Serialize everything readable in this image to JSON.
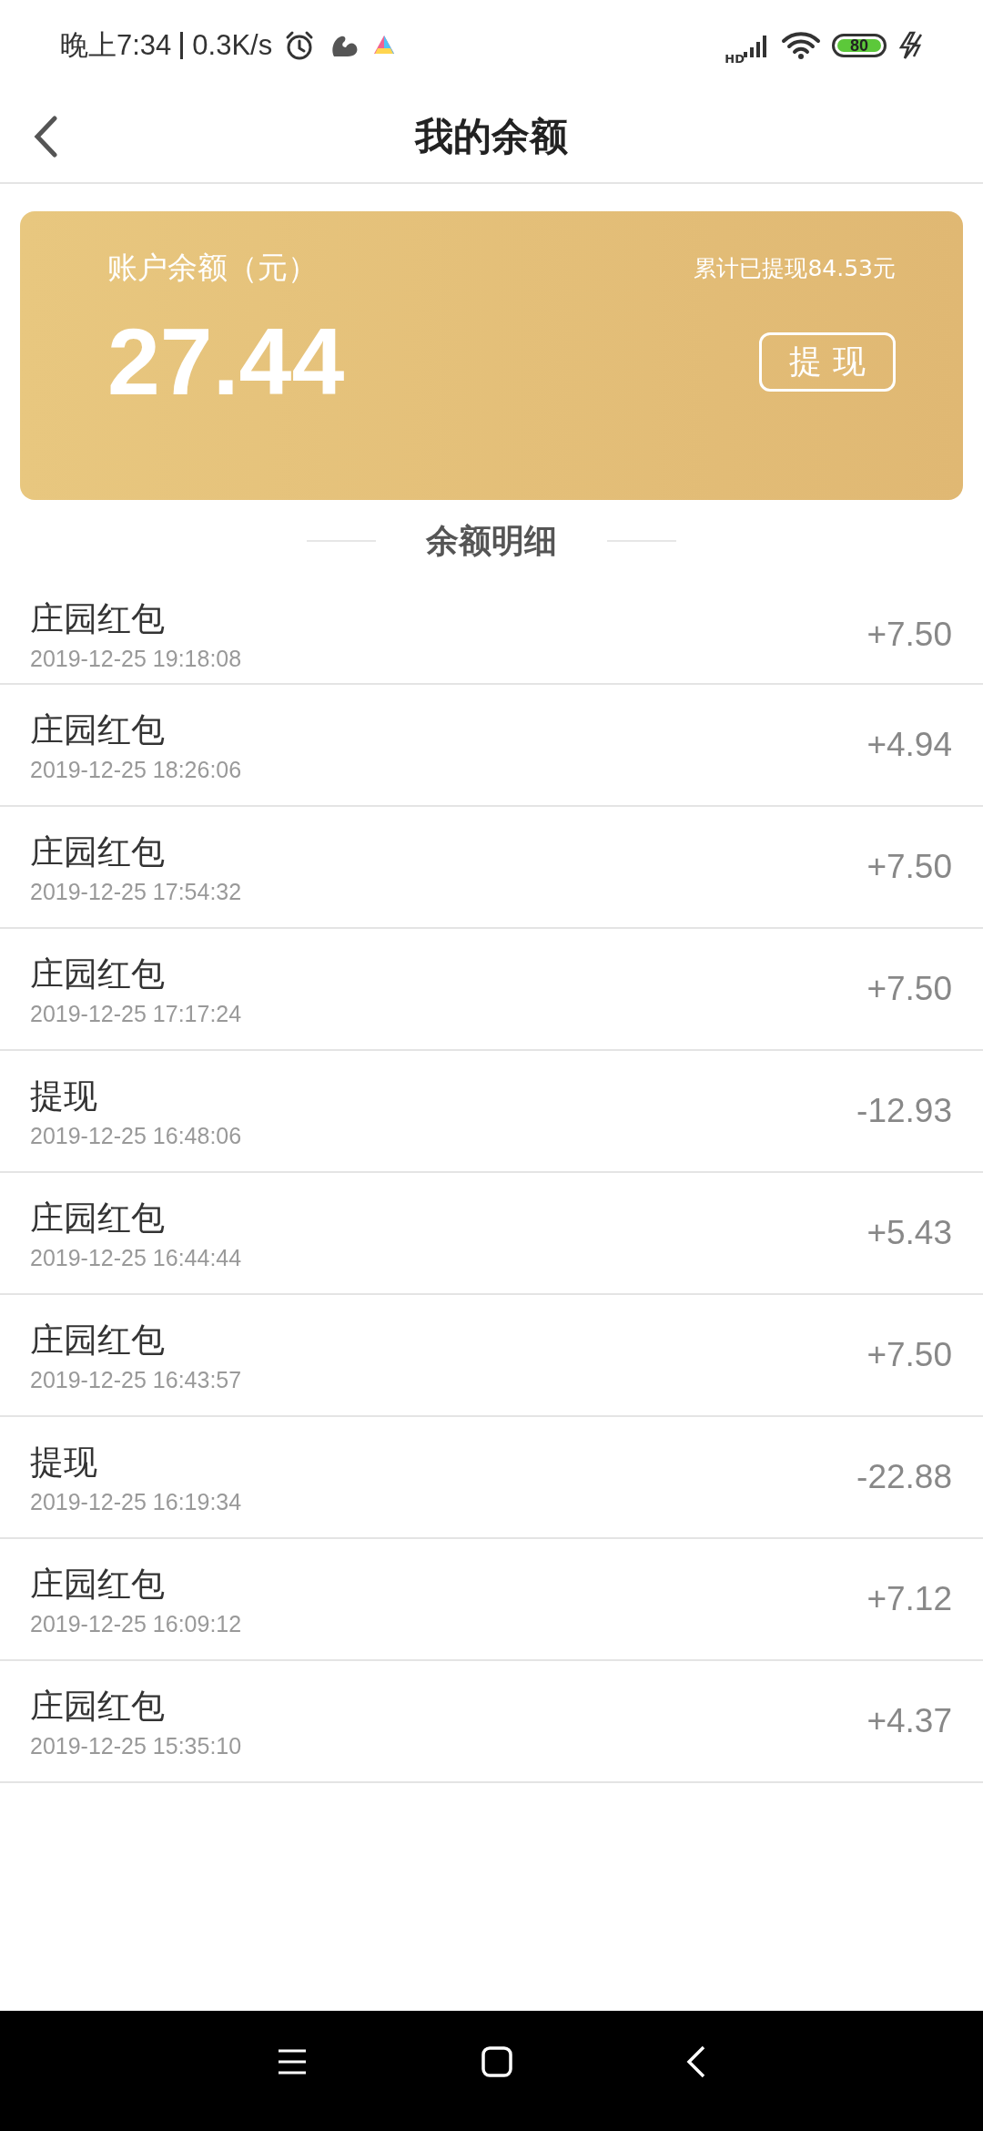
{
  "status_bar": {
    "time": "晚上7:34",
    "speed": "0.3K/s",
    "network": "HD",
    "battery": "80"
  },
  "header": {
    "title": "我的余额"
  },
  "balance_card": {
    "label": "账户余额（元）",
    "withdrawn_total": "累计已提现84.53元",
    "amount": "27.44",
    "withdraw_button": "提 现"
  },
  "section_title": "余额明细",
  "transactions": [
    {
      "title": "庄园红包",
      "time": "2019-12-25 19:18:08",
      "amount": "+7.50"
    },
    {
      "title": "庄园红包",
      "time": "2019-12-25 18:26:06",
      "amount": "+4.94"
    },
    {
      "title": "庄园红包",
      "time": "2019-12-25 17:54:32",
      "amount": "+7.50"
    },
    {
      "title": "庄园红包",
      "time": "2019-12-25 17:17:24",
      "amount": "+7.50"
    },
    {
      "title": "提现",
      "time": "2019-12-25 16:48:06",
      "amount": "-12.93"
    },
    {
      "title": "庄园红包",
      "time": "2019-12-25 16:44:44",
      "amount": "+5.43"
    },
    {
      "title": "庄园红包",
      "time": "2019-12-25 16:43:57",
      "amount": "+7.50"
    },
    {
      "title": "提现",
      "time": "2019-12-25 16:19:34",
      "amount": "-22.88"
    },
    {
      "title": "庄园红包",
      "time": "2019-12-25 16:09:12",
      "amount": "+7.12"
    },
    {
      "title": "庄园红包",
      "time": "2019-12-25 15:35:10",
      "amount": "+4.37"
    }
  ]
}
